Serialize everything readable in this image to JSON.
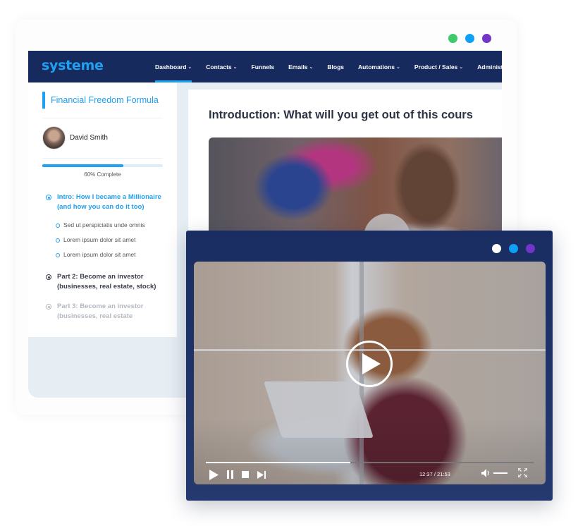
{
  "window_controls": {
    "back": [
      {
        "name": "green-dot",
        "color": "#3ccb6a"
      },
      {
        "name": "blue-dot",
        "color": "#0ea0f7"
      },
      {
        "name": "purple-dot",
        "color": "#7235c9"
      }
    ],
    "front": [
      {
        "name": "white-dot",
        "color": "#ffffff"
      },
      {
        "name": "blue-dot",
        "color": "#0ea0f7"
      },
      {
        "name": "purple-dot",
        "color": "#7235c9"
      }
    ]
  },
  "navbar": {
    "logo": "systeme",
    "items": [
      {
        "label": "Dashboard",
        "dropdown": true,
        "active": true
      },
      {
        "label": "Contacts",
        "dropdown": true
      },
      {
        "label": "Funnels",
        "dropdown": false
      },
      {
        "label": "Emails",
        "dropdown": true
      },
      {
        "label": "Blogs",
        "dropdown": false
      },
      {
        "label": "Automations",
        "dropdown": true
      },
      {
        "label": "Product / Sales",
        "dropdown": true
      },
      {
        "label": "Administration",
        "dropdown": true
      }
    ]
  },
  "sidebar": {
    "course_title": "Financial Freedom Formula",
    "author": {
      "name": "David Smith"
    },
    "progress": {
      "percent": 60,
      "label": "60% Complete"
    },
    "lessons": [
      {
        "title": "Intro: How I became a Millionaire (and how you can do it too)",
        "state": "active",
        "sublessons": [
          "Sed ut perspiciatis unde omnis",
          "Lorem ipsum dolor sit amet",
          "Lorem ipsum dolor sit amet"
        ]
      },
      {
        "title": "Part 2: Become an investor (businesses, real estate, stock)",
        "state": "normal"
      },
      {
        "title": "Part 3: Become an investor (businesses, real estate",
        "state": "muted"
      }
    ]
  },
  "main": {
    "heading": "Introduction: What will you get out of this cours"
  },
  "player": {
    "progress_percent": 44,
    "time": "12:37 / 21:53",
    "controls": [
      "play",
      "pause",
      "stop",
      "next"
    ]
  },
  "icons": {
    "chevron": "⌄"
  }
}
